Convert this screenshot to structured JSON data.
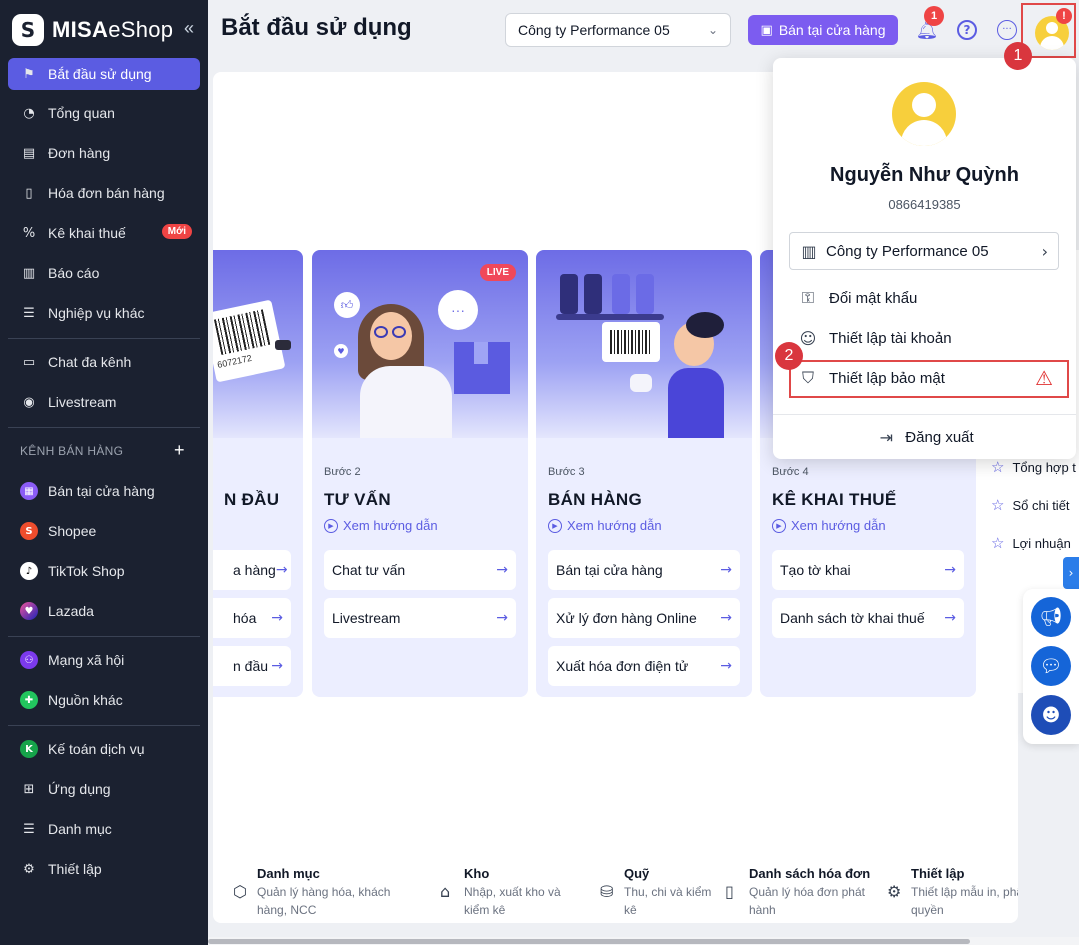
{
  "sidebar": {
    "brand_mark": "S",
    "brand_bold": "MISA",
    "brand_light": "eShop",
    "collapse_icon": "«",
    "items": [
      {
        "label": "Bắt đầu sử dụng",
        "icon": "flag-icon"
      },
      {
        "label": "Tổng quan",
        "icon": "dashboard-icon"
      },
      {
        "label": "Đơn hàng",
        "icon": "order-icon"
      },
      {
        "label": "Hóa đơn bán hàng",
        "icon": "invoice-icon"
      },
      {
        "label": "Kê khai thuế",
        "icon": "tax-icon",
        "badge": "Mới"
      },
      {
        "label": "Báo cáo",
        "icon": "report-icon"
      },
      {
        "label": "Nghiệp vụ khác",
        "icon": "list-icon"
      }
    ],
    "items2": [
      {
        "label": "Chat đa kênh",
        "icon": "chat-icon"
      },
      {
        "label": "Livestream",
        "icon": "livestream-icon"
      }
    ],
    "section_label": "KÊNH BÁN HÀNG",
    "channels": [
      {
        "label": "Bán tại cửa hàng",
        "icon": "store-icon",
        "color": "#8b5cf6"
      },
      {
        "label": "Shopee",
        "icon": "shopee-icon",
        "color": "#ee4d2d"
      },
      {
        "label": "TikTok Shop",
        "icon": "tiktok-icon",
        "color": "#ffffff"
      },
      {
        "label": "Lazada",
        "icon": "lazada-icon",
        "color": "#1a22b8"
      },
      {
        "label": "Mạng xã hội",
        "icon": "social-icon",
        "color": "#7c3aed"
      },
      {
        "label": "Nguồn khác",
        "icon": "other-source-icon",
        "color": "#22c55e"
      }
    ],
    "items3": [
      {
        "label": "Kế toán dịch vụ",
        "icon": "accounting-icon"
      },
      {
        "label": "Ứng dụng",
        "icon": "apps-icon"
      },
      {
        "label": "Danh mục",
        "icon": "menu-icon"
      },
      {
        "label": "Thiết lập",
        "icon": "settings-icon"
      }
    ]
  },
  "header": {
    "title": "Bắt đầu sử dụng",
    "company": "Công ty Performance 05",
    "store_button": "Bán tại cửa hàng",
    "notification_count": "1",
    "help_icon": "?",
    "more_icon": "···",
    "avatar_alert": "!"
  },
  "markers": {
    "one": "1",
    "two": "2"
  },
  "steps": [
    {
      "num": "",
      "title": "N ĐẦU",
      "guide": "",
      "actions": [
        "a hàng",
        "hóa",
        "n đầu"
      ]
    },
    {
      "num": "Bước 2",
      "title": "TƯ VẤN",
      "guide": "Xem hướng dẫn",
      "actions": [
        "Chat tư vấn",
        "Livestream"
      ],
      "badge": "LIVE"
    },
    {
      "num": "Bước 3",
      "title": "BÁN HÀNG",
      "guide": "Xem hướng dẫn",
      "actions": [
        "Bán tại cửa hàng",
        "Xử lý đơn hàng Online",
        "Xuất hóa đơn điện tử"
      ]
    },
    {
      "num": "Bước 4",
      "title": "KÊ KHAI THUẾ",
      "guide": "Xem hướng dẫn",
      "actions": [
        "Tạo tờ khai",
        "Danh sách tờ khai thuế"
      ]
    }
  ],
  "illustration_text": {
    "barcode_digits": "6072172",
    "chat_dots": "···"
  },
  "quick_links": [
    {
      "title": "Danh mục",
      "desc1": "Quản lý hàng hóa, khách",
      "desc2": "hàng, NCC",
      "icon": "box-icon"
    },
    {
      "title": "Kho",
      "desc1": "Nhập, xuất kho và",
      "desc2": "kiểm kê",
      "icon": "warehouse-icon"
    },
    {
      "title": "Quỹ",
      "desc1": "Thu, chi và kiểm",
      "desc2": "kê",
      "icon": "coins-icon"
    },
    {
      "title": "Danh sách hóa đơn",
      "desc1": "Quản lý hóa đơn phát",
      "desc2": "hành",
      "icon": "invoice-list-icon"
    },
    {
      "title": "Thiết lập",
      "desc1": "Thiết lập mẫu in, phân",
      "desc2": "quyền",
      "icon": "settings-icon"
    }
  ],
  "favorites": [
    "Tổng hợp t",
    "Sổ chi tiết",
    "Lợi nhuận"
  ],
  "profile": {
    "name": "Nguyễn Như Quỳnh",
    "phone": "0866419385",
    "company": "Công ty Performance 05",
    "change_password": "Đổi mật khẩu",
    "account_settings": "Thiết lập tài khoản",
    "security_settings": "Thiết lập bảo mật",
    "logout": "Đăng xuất"
  }
}
